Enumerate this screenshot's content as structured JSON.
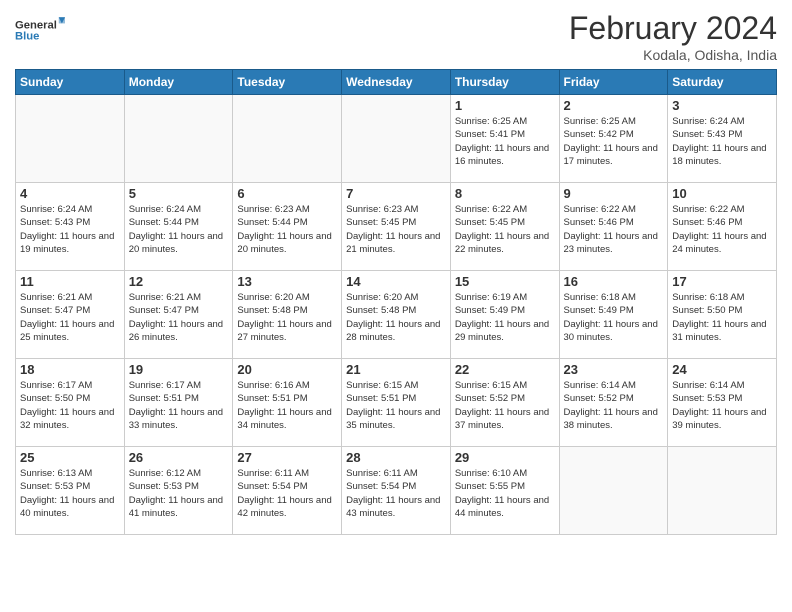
{
  "header": {
    "logo_line1": "General",
    "logo_line2": "Blue",
    "month_title": "February 2024",
    "location": "Kodala, Odisha, India"
  },
  "days_of_week": [
    "Sunday",
    "Monday",
    "Tuesday",
    "Wednesday",
    "Thursday",
    "Friday",
    "Saturday"
  ],
  "weeks": [
    [
      {
        "day": "",
        "info": ""
      },
      {
        "day": "",
        "info": ""
      },
      {
        "day": "",
        "info": ""
      },
      {
        "day": "",
        "info": ""
      },
      {
        "day": "1",
        "info": "Sunrise: 6:25 AM\nSunset: 5:41 PM\nDaylight: 11 hours and 16 minutes."
      },
      {
        "day": "2",
        "info": "Sunrise: 6:25 AM\nSunset: 5:42 PM\nDaylight: 11 hours and 17 minutes."
      },
      {
        "day": "3",
        "info": "Sunrise: 6:24 AM\nSunset: 5:43 PM\nDaylight: 11 hours and 18 minutes."
      }
    ],
    [
      {
        "day": "4",
        "info": "Sunrise: 6:24 AM\nSunset: 5:43 PM\nDaylight: 11 hours and 19 minutes."
      },
      {
        "day": "5",
        "info": "Sunrise: 6:24 AM\nSunset: 5:44 PM\nDaylight: 11 hours and 20 minutes."
      },
      {
        "day": "6",
        "info": "Sunrise: 6:23 AM\nSunset: 5:44 PM\nDaylight: 11 hours and 20 minutes."
      },
      {
        "day": "7",
        "info": "Sunrise: 6:23 AM\nSunset: 5:45 PM\nDaylight: 11 hours and 21 minutes."
      },
      {
        "day": "8",
        "info": "Sunrise: 6:22 AM\nSunset: 5:45 PM\nDaylight: 11 hours and 22 minutes."
      },
      {
        "day": "9",
        "info": "Sunrise: 6:22 AM\nSunset: 5:46 PM\nDaylight: 11 hours and 23 minutes."
      },
      {
        "day": "10",
        "info": "Sunrise: 6:22 AM\nSunset: 5:46 PM\nDaylight: 11 hours and 24 minutes."
      }
    ],
    [
      {
        "day": "11",
        "info": "Sunrise: 6:21 AM\nSunset: 5:47 PM\nDaylight: 11 hours and 25 minutes."
      },
      {
        "day": "12",
        "info": "Sunrise: 6:21 AM\nSunset: 5:47 PM\nDaylight: 11 hours and 26 minutes."
      },
      {
        "day": "13",
        "info": "Sunrise: 6:20 AM\nSunset: 5:48 PM\nDaylight: 11 hours and 27 minutes."
      },
      {
        "day": "14",
        "info": "Sunrise: 6:20 AM\nSunset: 5:48 PM\nDaylight: 11 hours and 28 minutes."
      },
      {
        "day": "15",
        "info": "Sunrise: 6:19 AM\nSunset: 5:49 PM\nDaylight: 11 hours and 29 minutes."
      },
      {
        "day": "16",
        "info": "Sunrise: 6:18 AM\nSunset: 5:49 PM\nDaylight: 11 hours and 30 minutes."
      },
      {
        "day": "17",
        "info": "Sunrise: 6:18 AM\nSunset: 5:50 PM\nDaylight: 11 hours and 31 minutes."
      }
    ],
    [
      {
        "day": "18",
        "info": "Sunrise: 6:17 AM\nSunset: 5:50 PM\nDaylight: 11 hours and 32 minutes."
      },
      {
        "day": "19",
        "info": "Sunrise: 6:17 AM\nSunset: 5:51 PM\nDaylight: 11 hours and 33 minutes."
      },
      {
        "day": "20",
        "info": "Sunrise: 6:16 AM\nSunset: 5:51 PM\nDaylight: 11 hours and 34 minutes."
      },
      {
        "day": "21",
        "info": "Sunrise: 6:15 AM\nSunset: 5:51 PM\nDaylight: 11 hours and 35 minutes."
      },
      {
        "day": "22",
        "info": "Sunrise: 6:15 AM\nSunset: 5:52 PM\nDaylight: 11 hours and 37 minutes."
      },
      {
        "day": "23",
        "info": "Sunrise: 6:14 AM\nSunset: 5:52 PM\nDaylight: 11 hours and 38 minutes."
      },
      {
        "day": "24",
        "info": "Sunrise: 6:14 AM\nSunset: 5:53 PM\nDaylight: 11 hours and 39 minutes."
      }
    ],
    [
      {
        "day": "25",
        "info": "Sunrise: 6:13 AM\nSunset: 5:53 PM\nDaylight: 11 hours and 40 minutes."
      },
      {
        "day": "26",
        "info": "Sunrise: 6:12 AM\nSunset: 5:53 PM\nDaylight: 11 hours and 41 minutes."
      },
      {
        "day": "27",
        "info": "Sunrise: 6:11 AM\nSunset: 5:54 PM\nDaylight: 11 hours and 42 minutes."
      },
      {
        "day": "28",
        "info": "Sunrise: 6:11 AM\nSunset: 5:54 PM\nDaylight: 11 hours and 43 minutes."
      },
      {
        "day": "29",
        "info": "Sunrise: 6:10 AM\nSunset: 5:55 PM\nDaylight: 11 hours and 44 minutes."
      },
      {
        "day": "",
        "info": ""
      },
      {
        "day": "",
        "info": ""
      }
    ]
  ]
}
